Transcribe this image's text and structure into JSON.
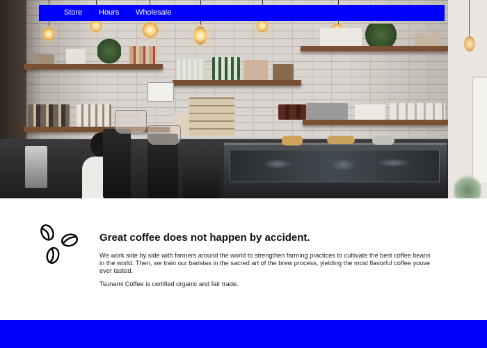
{
  "nav": {
    "items": [
      {
        "label": "Store"
      },
      {
        "label": "Hours"
      },
      {
        "label": "Wholesale"
      }
    ]
  },
  "hero": {
    "image": "coffee-shop-interior"
  },
  "intro": {
    "icon": "coffee-beans-icon",
    "headline": "Great coffee does not happen by accident.",
    "paragraph1": "We work side by side with farmers around the world to strengthen farming practices to cultivate the best coffee beans in the world. Then, we train our baristas in the sacred art of the brew process, yielding the most flavorful coffee youve ever tasted.",
    "paragraph2": "Tsunami Coffee is certified organic and fair trade."
  },
  "colors": {
    "accent": "#0000ff",
    "text": "#111111",
    "background": "#ffffff"
  }
}
